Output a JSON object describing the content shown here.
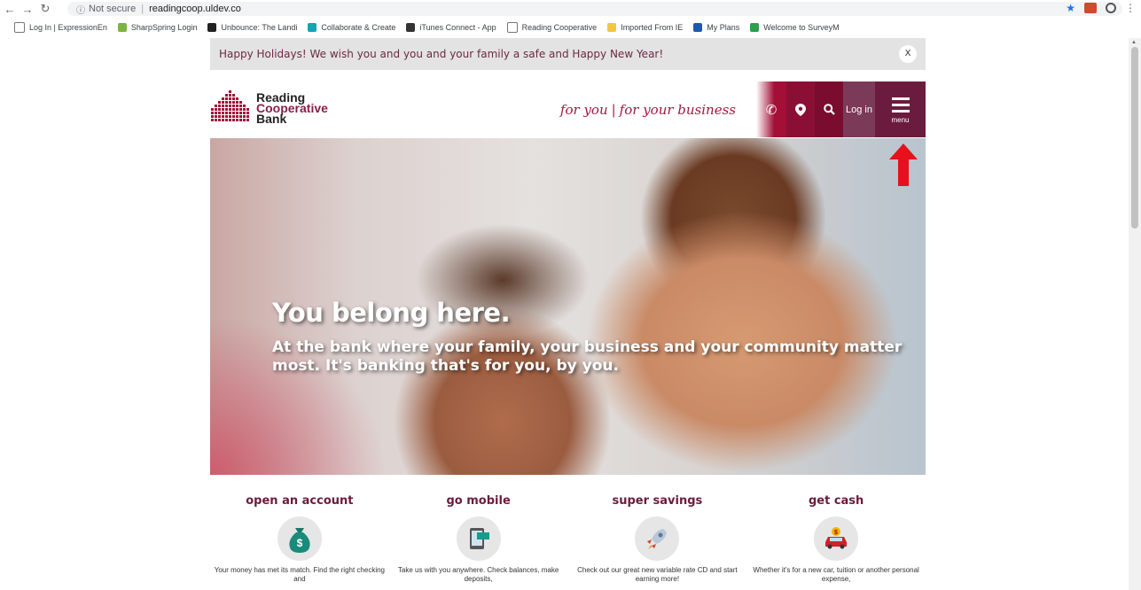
{
  "browser": {
    "url_security": "Not secure",
    "url": "readingcoop.uldev.co",
    "bookmarks": [
      {
        "label": "Log In | ExpressionEn",
        "color": "#ffffff"
      },
      {
        "label": "SharpSpring Login",
        "color": "#7cb342"
      },
      {
        "label": "Unbounce: The Landi",
        "color": "#222222"
      },
      {
        "label": "Collaborate & Create",
        "color": "#17a2b8"
      },
      {
        "label": "iTunes Connect - App",
        "color": "#333333"
      },
      {
        "label": "Reading Cooperative",
        "color": "#ffffff"
      },
      {
        "label": "Imported From IE",
        "color": "#f4c542"
      },
      {
        "label": "My Plans",
        "color": "#1e5aa8"
      },
      {
        "label": "Welcome to SurveyM",
        "color": "#2e9e4f"
      }
    ]
  },
  "banner": {
    "text": "Happy Holidays! We wish you and you and your family a safe and Happy New Year!",
    "close": "X"
  },
  "logo": {
    "line1": "Reading",
    "line2": "Cooperative",
    "line3": "Bank"
  },
  "header": {
    "tag_you": "for you",
    "tag_business": "for your business",
    "login": "Log in",
    "menu": "menu"
  },
  "hero": {
    "title": "You belong here.",
    "subtitle": "At the bank where your family, your business and your community matter most. It's banking that's for you, by you."
  },
  "features": [
    {
      "title": "open an account",
      "icon": "money-bag-icon",
      "desc": "Your money has met its match. Find the right checking and"
    },
    {
      "title": "go mobile",
      "icon": "mobile-phone-icon",
      "desc": "Take us with you anywhere. Check balances, make deposits,"
    },
    {
      "title": "super savings",
      "icon": "rocket-icon",
      "desc": "Check out our great new variable rate CD and start earning more!"
    },
    {
      "title": "get cash",
      "icon": "car-icon",
      "desc": "Whether it's for a new car, tuition or another personal expense,"
    }
  ],
  "colors": {
    "brand": "#6b1c3e",
    "accent": "#a30f37"
  }
}
